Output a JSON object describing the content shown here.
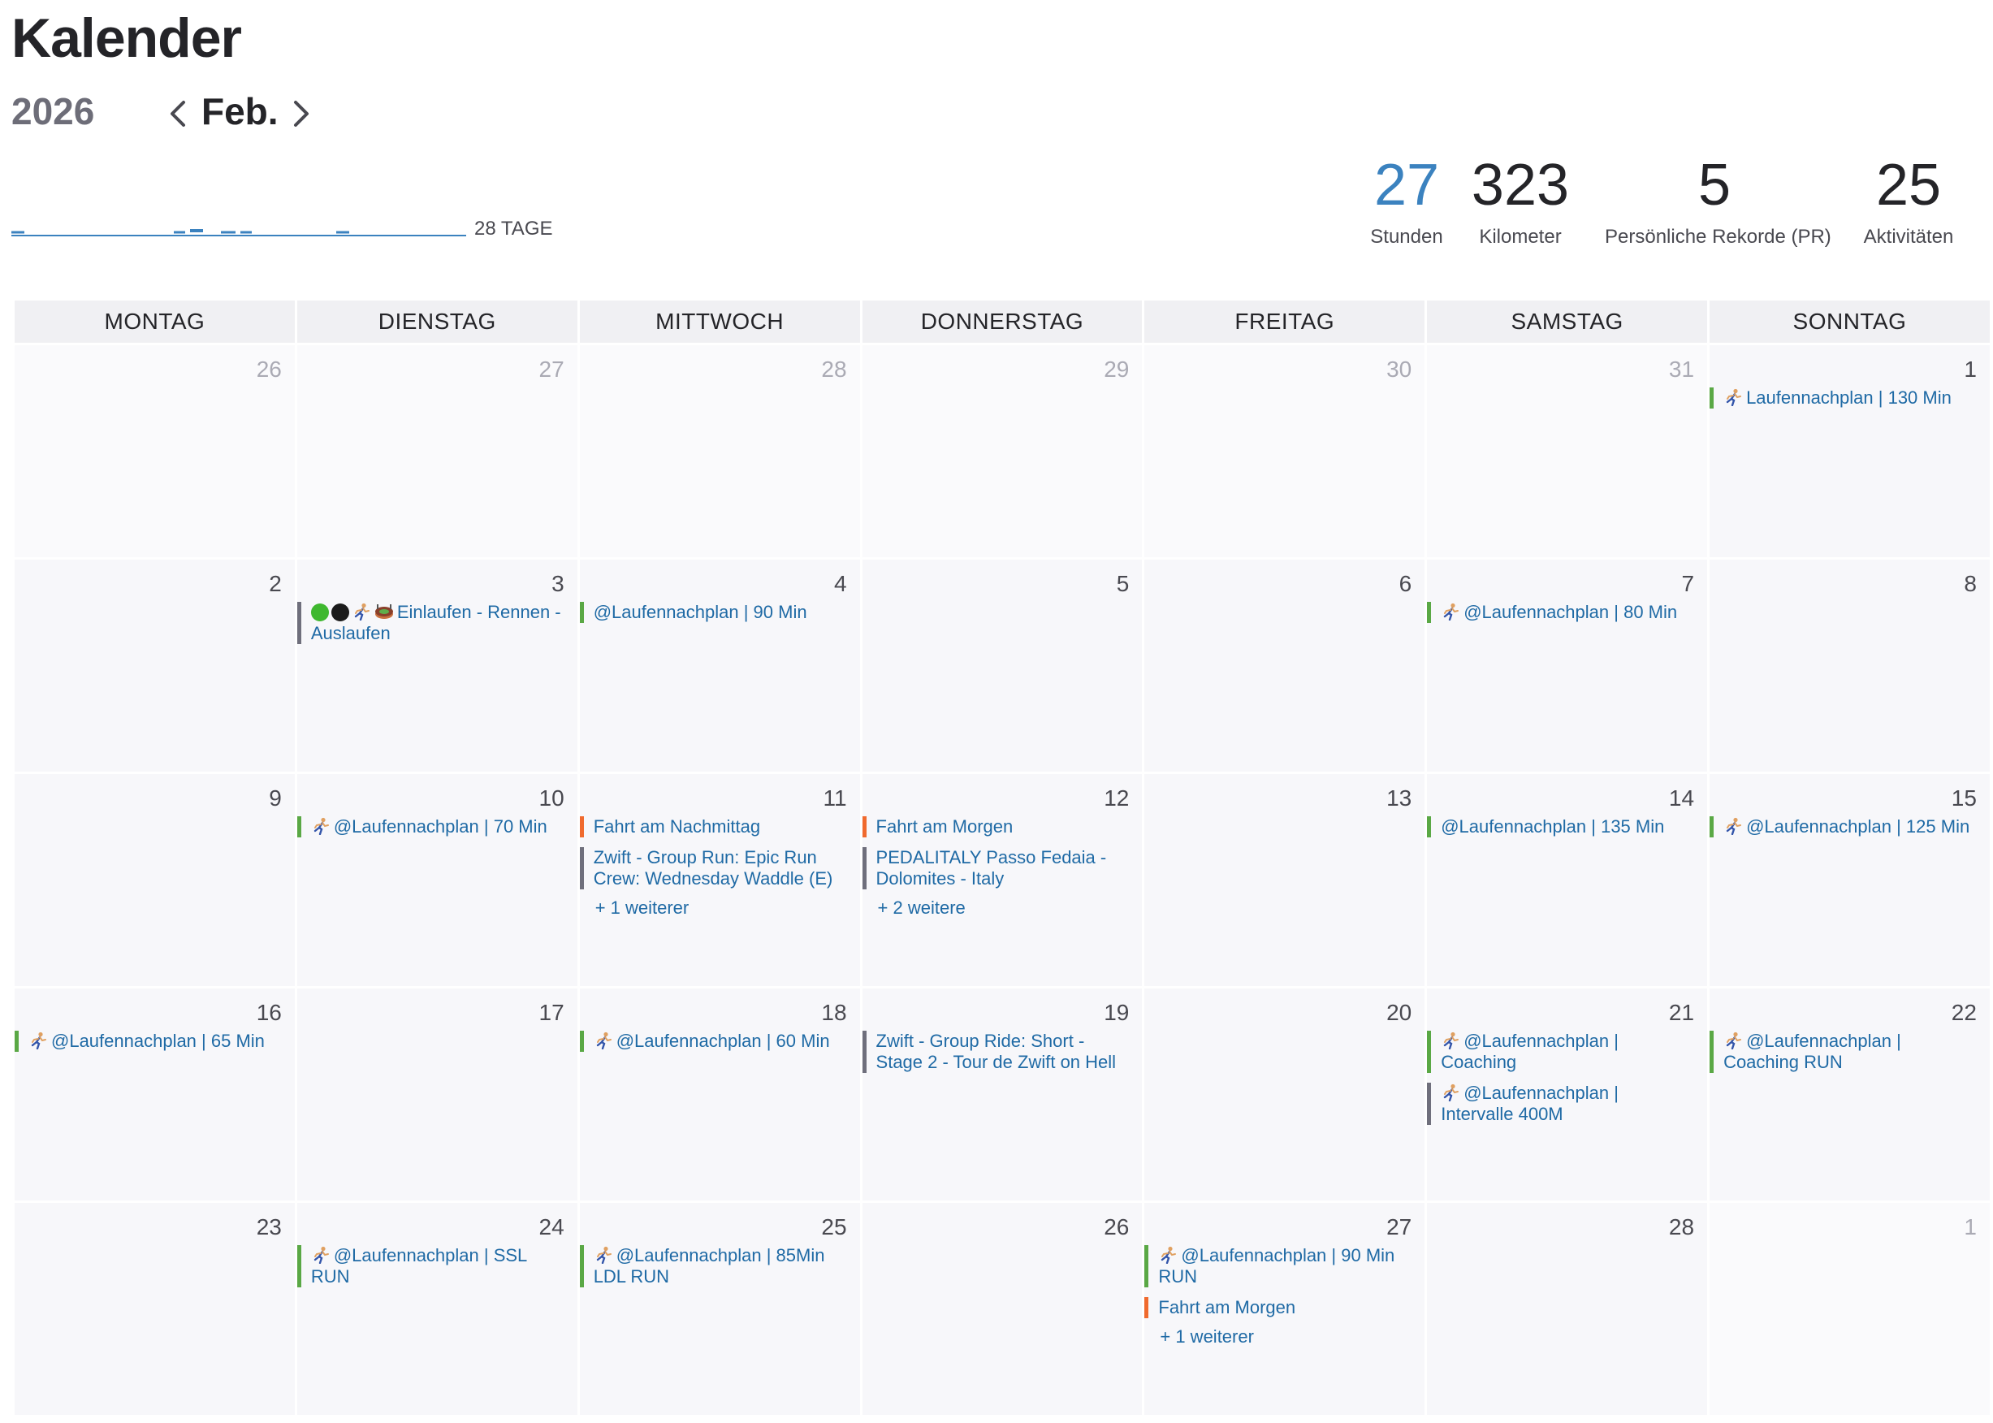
{
  "header": {
    "title": "Kalender",
    "year": "2026",
    "month": "Feb.",
    "days_label": "28 TAGE",
    "accent_color": "#3b82bf"
  },
  "stats": [
    {
      "value": "27",
      "label": "Stunden",
      "accent": true
    },
    {
      "value": "323",
      "label": "Kilometer",
      "accent": false
    },
    {
      "value": "5",
      "label": "Persönliche Rekorde (PR)",
      "accent": false
    },
    {
      "value": "25",
      "label": "Aktivitäten",
      "accent": false
    }
  ],
  "weekdays": [
    "MONTAG",
    "DIENSTAG",
    "MITTWOCH",
    "DONNERSTAG",
    "FREITAG",
    "SAMSTAG",
    "SONNTAG"
  ],
  "colors": {
    "run": "#5aa845",
    "ride": "#f06a2e",
    "other": "#6f6f7c"
  },
  "weeks": [
    [
      {
        "day": "26",
        "other": true,
        "events": []
      },
      {
        "day": "27",
        "other": true,
        "events": []
      },
      {
        "day": "28",
        "other": true,
        "events": []
      },
      {
        "day": "29",
        "other": true,
        "events": []
      },
      {
        "day": "30",
        "other": true,
        "events": []
      },
      {
        "day": "31",
        "other": true,
        "events": []
      },
      {
        "day": "1",
        "events": [
          {
            "text": "Laufennachplan | 130 Min",
            "color": "green",
            "icons": [
              "runner-icon"
            ]
          }
        ]
      }
    ],
    [
      {
        "day": "2",
        "events": []
      },
      {
        "day": "3",
        "events": [
          {
            "text": "Einlaufen - Rennen - Auslaufen",
            "color": "gray",
            "icons": [
              "green-circle-icon",
              "black-circle-icon",
              "runner-icon",
              "stadium-icon"
            ]
          }
        ]
      },
      {
        "day": "4",
        "events": [
          {
            "text": "@Laufennachplan | 90 Min",
            "color": "green",
            "icons": []
          }
        ]
      },
      {
        "day": "5",
        "events": []
      },
      {
        "day": "6",
        "events": []
      },
      {
        "day": "7",
        "events": [
          {
            "text": "@Laufennachplan | 80 Min",
            "color": "green",
            "icons": [
              "runner-icon"
            ]
          }
        ]
      },
      {
        "day": "8",
        "events": []
      }
    ],
    [
      {
        "day": "9",
        "events": []
      },
      {
        "day": "10",
        "events": [
          {
            "text": "@Laufennachplan | 70 Min",
            "color": "green",
            "icons": [
              "runner-icon"
            ]
          }
        ]
      },
      {
        "day": "11",
        "events": [
          {
            "text": "Fahrt am Nachmittag",
            "color": "orange",
            "icons": []
          },
          {
            "text": "Zwift - Group Run: Epic Run Crew: Wednesday Waddle (E)",
            "color": "gray",
            "icons": []
          }
        ],
        "more": "+ 1 weiterer"
      },
      {
        "day": "12",
        "events": [
          {
            "text": "Fahrt am Morgen",
            "color": "orange",
            "icons": []
          },
          {
            "text": "PEDALITALY Passo Fedaia - Dolomites - Italy",
            "color": "gray",
            "icons": []
          }
        ],
        "more": "+ 2 weitere"
      },
      {
        "day": "13",
        "events": []
      },
      {
        "day": "14",
        "events": [
          {
            "text": "@Laufennachplan | 135 Min",
            "color": "green",
            "icons": []
          }
        ]
      },
      {
        "day": "15",
        "events": [
          {
            "text": "@Laufennachplan | 125 Min",
            "color": "green",
            "icons": [
              "runner-icon"
            ]
          }
        ]
      }
    ],
    [
      {
        "day": "16",
        "events": [
          {
            "text": "@Laufennachplan | 65 Min",
            "color": "green",
            "icons": [
              "runner-icon"
            ]
          }
        ]
      },
      {
        "day": "17",
        "events": []
      },
      {
        "day": "18",
        "events": [
          {
            "text": "@Laufennachplan | 60 Min",
            "color": "green",
            "icons": [
              "runner-icon"
            ]
          }
        ]
      },
      {
        "day": "19",
        "events": [
          {
            "text": "Zwift - Group Ride: Short - Stage 2 - Tour de Zwift on Hell",
            "color": "gray",
            "icons": []
          }
        ]
      },
      {
        "day": "20",
        "events": []
      },
      {
        "day": "21",
        "events": [
          {
            "text": "@Laufennachplan | Coaching",
            "color": "green",
            "icons": [
              "runner-icon"
            ]
          },
          {
            "text": "@Laufennachplan | Intervalle 400M",
            "color": "gray",
            "icons": [
              "runner-icon"
            ]
          }
        ]
      },
      {
        "day": "22",
        "events": [
          {
            "text": "@Laufennachplan | Coaching RUN",
            "color": "green",
            "icons": [
              "runner-icon"
            ]
          }
        ]
      }
    ],
    [
      {
        "day": "23",
        "events": []
      },
      {
        "day": "24",
        "events": [
          {
            "text": "@Laufennachplan | SSL RUN",
            "color": "green",
            "icons": [
              "runner-icon"
            ]
          }
        ]
      },
      {
        "day": "25",
        "events": [
          {
            "text": "@Laufennachplan | 85Min LDL RUN",
            "color": "green",
            "icons": [
              "runner-icon"
            ]
          }
        ]
      },
      {
        "day": "26",
        "events": []
      },
      {
        "day": "27",
        "events": [
          {
            "text": "@Laufennachplan | 90 Min RUN",
            "color": "green",
            "icons": [
              "runner-icon"
            ]
          },
          {
            "text": "Fahrt am Morgen",
            "color": "orange",
            "icons": []
          }
        ],
        "more": "+ 1 weiterer"
      },
      {
        "day": "28",
        "events": []
      },
      {
        "day": "1",
        "other": true,
        "events": []
      }
    ]
  ]
}
